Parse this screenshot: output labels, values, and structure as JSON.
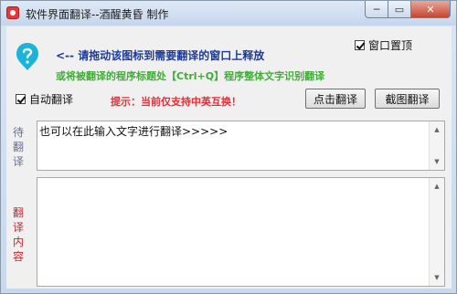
{
  "window": {
    "title": "软件界面翻译--酒醒黄昏 制作",
    "controls": {
      "minimize": "─",
      "maximize": "▭",
      "close": "✕"
    }
  },
  "instructions": {
    "line1": "<-- 请拖动该图标到需要翻译的窗口上释放",
    "line2": "或将被翻译的程序标题处【Ctrl+Q】程序整体文字识别翻译"
  },
  "options": {
    "topmost_label": "窗口置顶",
    "topmost_checked": true,
    "auto_translate_label": "自动翻译",
    "auto_translate_checked": true
  },
  "hint": "提示：当前仅支持中英互换！",
  "buttons": {
    "translate": "点击翻译",
    "capture_translate": "截图翻译"
  },
  "source": {
    "label": "待翻译",
    "text": "也可以在此输入文字进行翻译>>>>>"
  },
  "result": {
    "label": "翻译内容",
    "text": ""
  },
  "icons": {
    "drag_target": "drag-target-icon",
    "app": "app-icon"
  },
  "colors": {
    "instruction_blue": "#1c3a9c",
    "instruction_green": "#3fae36",
    "hint_red": "#e0303a",
    "drag_icon": "#1ab3d9"
  }
}
